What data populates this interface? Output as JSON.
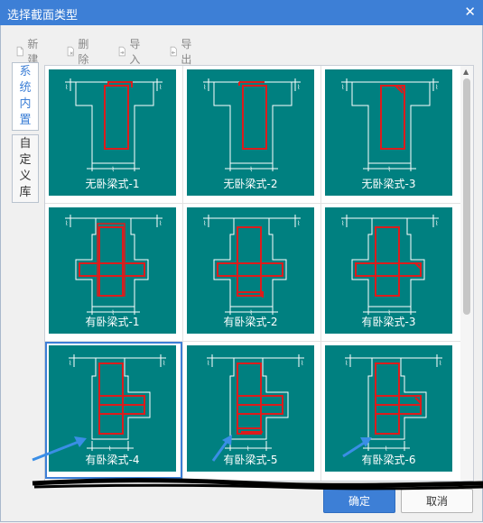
{
  "dialog": {
    "title": "选择截面类型"
  },
  "toolbar": {
    "new": "新建",
    "delete": "删除",
    "import": "导入",
    "export": "导出"
  },
  "tabs": [
    {
      "label": "系统内置"
    },
    {
      "label": "自定义库"
    }
  ],
  "sections": [
    {
      "label": "无卧梁式-1",
      "kind": "plain",
      "variant": 1
    },
    {
      "label": "无卧梁式-2",
      "kind": "plain",
      "variant": 2
    },
    {
      "label": "无卧梁式-3",
      "kind": "plain",
      "variant": 3
    },
    {
      "label": "有卧梁式-1",
      "kind": "cross",
      "variant": 1
    },
    {
      "label": "有卧梁式-2",
      "kind": "cross",
      "variant": 2
    },
    {
      "label": "有卧梁式-3",
      "kind": "cross",
      "variant": 3
    },
    {
      "label": "有卧梁式-4",
      "kind": "side",
      "variant": 1,
      "selected": true
    },
    {
      "label": "有卧梁式-5",
      "kind": "side",
      "variant": 2
    },
    {
      "label": "有卧梁式-6",
      "kind": "side",
      "variant": 3
    }
  ],
  "buttons": {
    "ok": "确定",
    "cancel": "取消"
  },
  "colors": {
    "accent": "#3d7fd6",
    "teal": "#008080",
    "rebar": "#dd1c1c",
    "outline": "#ffffff"
  }
}
